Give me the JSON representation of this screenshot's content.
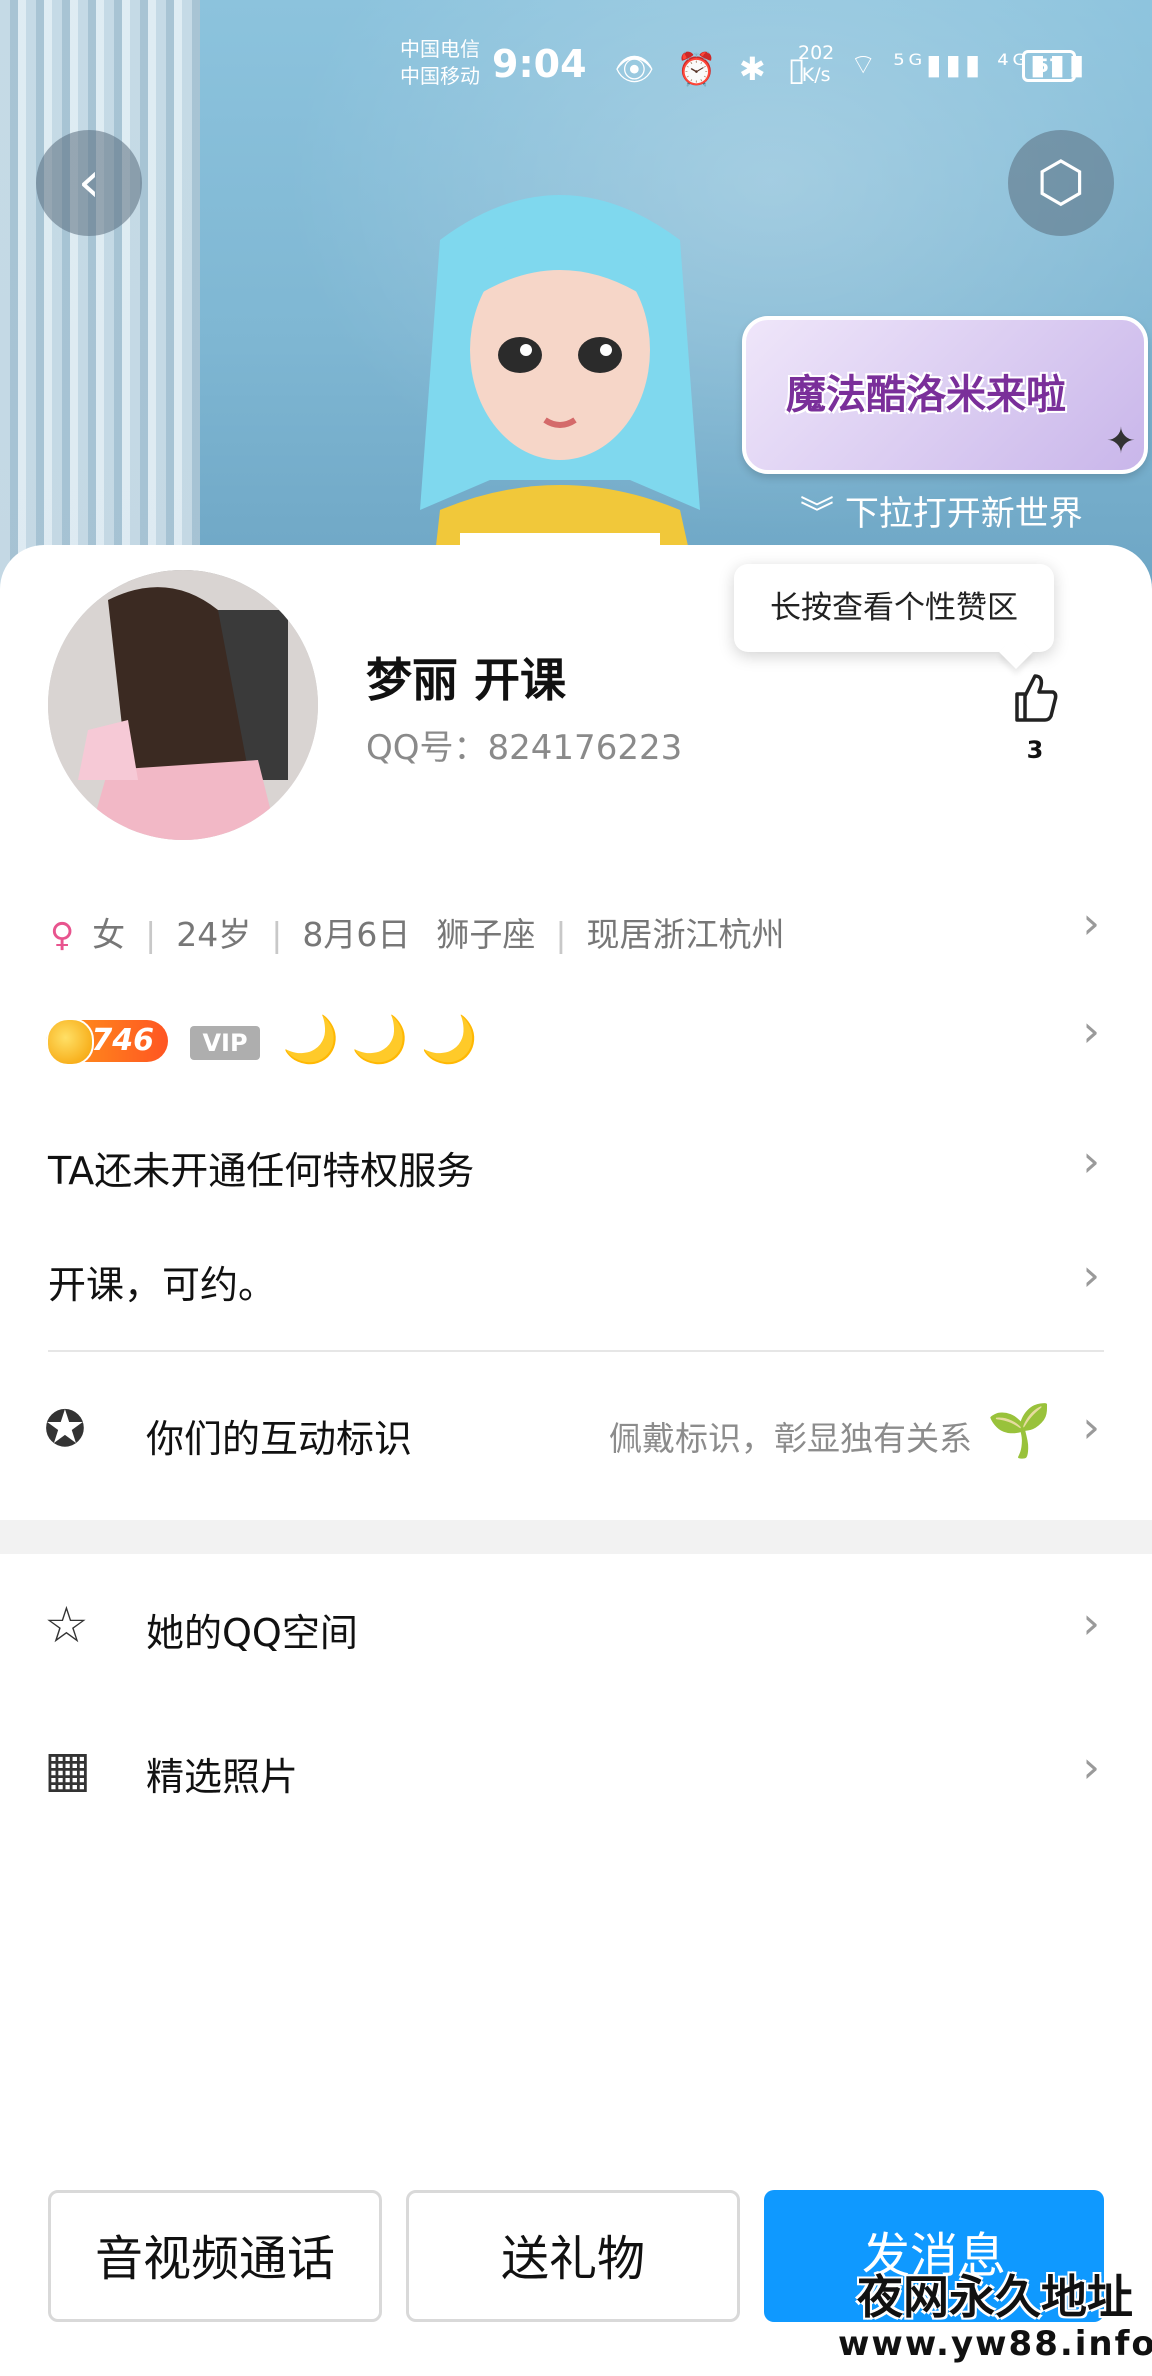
{
  "status_bar": {
    "carrier1": "中国电信",
    "carrier2": "中国移动",
    "time": "9:04",
    "icons": "👁 ⏰ ✱ ▯",
    "net_speed_value": "202",
    "net_speed_unit": "K/s",
    "signal": "⌔ ⁵ᴳ▮▮▮ ⁴ᴳ▮▮▮",
    "battery": "57"
  },
  "hero": {
    "back_glyph": "‹",
    "cube_glyph": "⬡",
    "banner_text": "魔法酷洛米来啦",
    "pull_hint": "下拉打开新世界"
  },
  "profile": {
    "name": "梦丽 开课",
    "qq_label": "QQ号：",
    "qq_number": "824176223",
    "tooltip": "长按查看个性赞区",
    "like_count": "3"
  },
  "info": {
    "gender_symbol": "♀",
    "gender": "女",
    "age": "24岁",
    "birthday": "8月6日",
    "zodiac": "狮子座",
    "location": "现居浙江杭州"
  },
  "level": {
    "value": "746",
    "vip": "VIP",
    "moons": "🌙🌙🌙"
  },
  "rows": {
    "privilege": "TA还未开通任何特权服务",
    "signature": "开课，可约。",
    "interaction_label": "你们的互动标识",
    "interaction_hint": "佩戴标识，彰显独有关系",
    "qzone_label": "她的QQ空间",
    "photos_label": "精选照片"
  },
  "icons": {
    "chevron": "›",
    "like": "👍",
    "interaction": "✪",
    "qzone": "☆",
    "photos": "▦",
    "sprout": "🌱"
  },
  "actions": {
    "call": "音视频通话",
    "gift": "送礼物",
    "message": "发消息"
  },
  "watermark": {
    "line1": "夜网永久地址",
    "line2": "www.yw88.info"
  },
  "colors": {
    "primary": "#0f99ff",
    "gender": "#e8548e",
    "level_badge": "#ff5522",
    "vip_badge": "#aeaeae"
  }
}
